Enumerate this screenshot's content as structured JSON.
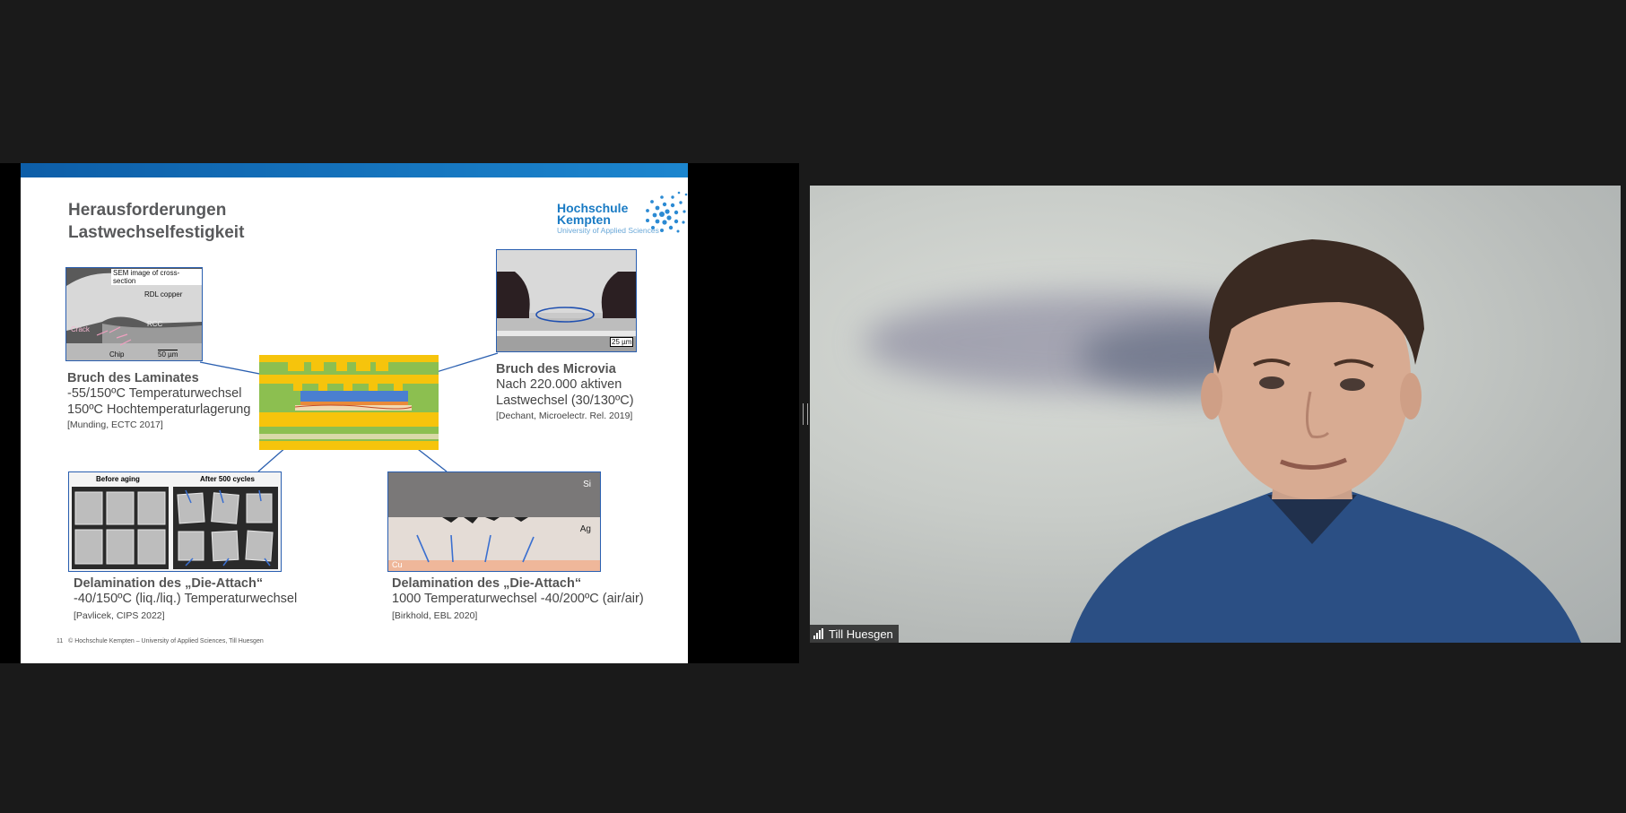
{
  "slide": {
    "title_line1": "Herausforderungen",
    "title_line2": "Lastwechselfestigkeit",
    "logo": {
      "line1": "Hochschule",
      "line2": "Kempten",
      "sub": "University of Applied Sciences"
    },
    "panels": {
      "laminate": {
        "image_labels": {
          "caption": "SEM image of cross-section",
          "rdl": "RDL copper",
          "rcc": "RCC",
          "crack": "Crack",
          "chip": "Chip",
          "scale": "50 µm"
        },
        "heading": "Bruch des Laminates",
        "line1": "-55/150ºC Temperaturwechsel",
        "line2": "150ºC Hochtemperaturlagerung",
        "ref": "[Munding, ECTC 2017]"
      },
      "microvia": {
        "image_labels": {
          "scale": "25 µm"
        },
        "heading": "Bruch des Microvia",
        "line1": "Nach 220.000 aktiven",
        "line2": "Lastwechsel (30/130ºC)",
        "ref": "[Dechant, Microelectr. Rel. 2019]"
      },
      "die_attach_1": {
        "image_labels": {
          "before": "Before aging",
          "after": "After 500 cycles"
        },
        "heading": "Delamination des „Die-Attach“",
        "line1": "-40/150ºC (liq./liq.) Temperaturwechsel",
        "ref": "[Pavlicek, CIPS 2022]"
      },
      "die_attach_2": {
        "image_labels": {
          "si": "Si",
          "ag": "Ag",
          "cu": "Cu"
        },
        "heading": "Delamination des „Die-Attach“",
        "line1": "1000 Temperaturwechsel -40/200ºC (air/air)",
        "ref": "[Birkhold, EBL 2020]"
      }
    },
    "footer": {
      "page": "11",
      "text": "© Hochschule Kempten – University of Applied Sciences, Till Huesgen"
    }
  },
  "participant": {
    "name": "Till Huesgen"
  },
  "colors": {
    "slide_bar": "#1c86cf",
    "connector": "#2a5fb0",
    "pcb_green": "#8cbf50",
    "pcb_yellow": "#f6c40c"
  }
}
